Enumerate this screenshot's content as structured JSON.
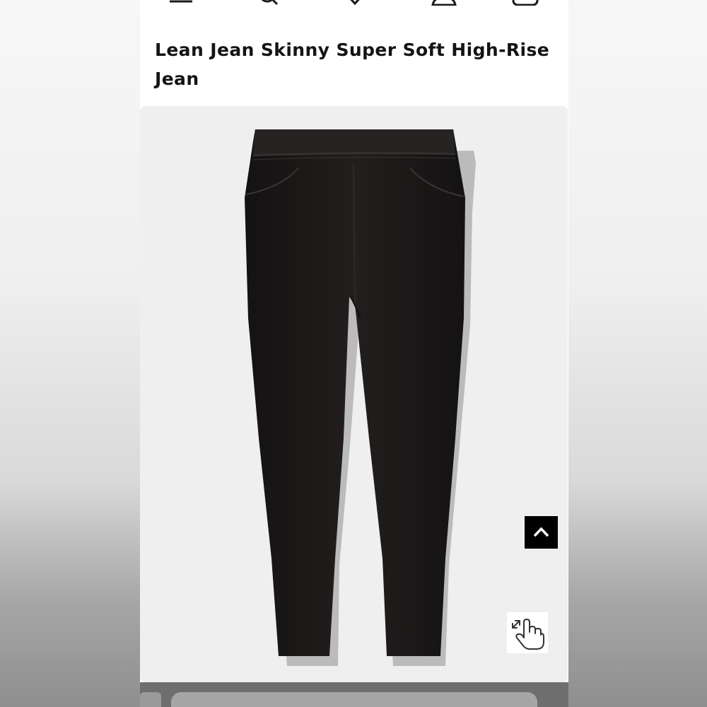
{
  "product": {
    "title": "Lean Jean Skinny Super Soft High-Rise Jean"
  },
  "nav": {
    "icons": [
      "menu-icon",
      "search-icon",
      "heart-icon",
      "account-icon",
      "bag-icon"
    ]
  },
  "gallery": {
    "image_subject": "black skinny pull-on jeans",
    "back_to_top_icon": "chevron-up-icon",
    "zoom_icon": "tap-to-zoom-icon"
  },
  "colors": {
    "title_text": "#141414",
    "gallery_bg": "#efefef",
    "denim": "#1e1b1b",
    "button_bg": "#000000"
  }
}
